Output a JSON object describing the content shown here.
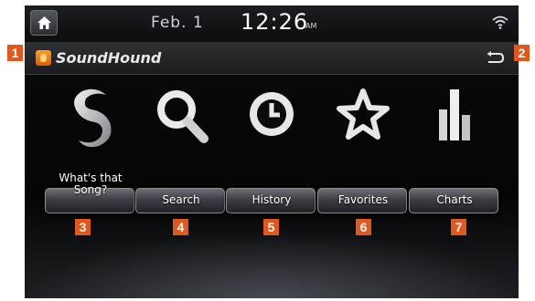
{
  "status_bar": {
    "date": "Feb.  1",
    "time": "12:26",
    "ampm": "AM"
  },
  "app_bar": {
    "title": "SoundHound"
  },
  "tiles": [
    {
      "label": "What's that Song?",
      "badge": "3"
    },
    {
      "label": "Search",
      "badge": "4"
    },
    {
      "label": "History",
      "badge": "5"
    },
    {
      "label": "Favorites",
      "badge": "6"
    },
    {
      "label": "Charts",
      "badge": "7"
    }
  ],
  "callouts": {
    "title_badge": "1",
    "back_badge": "2"
  },
  "colors": {
    "badge": "#e2571b",
    "logo": "#ff8a10",
    "background": "#050608"
  }
}
